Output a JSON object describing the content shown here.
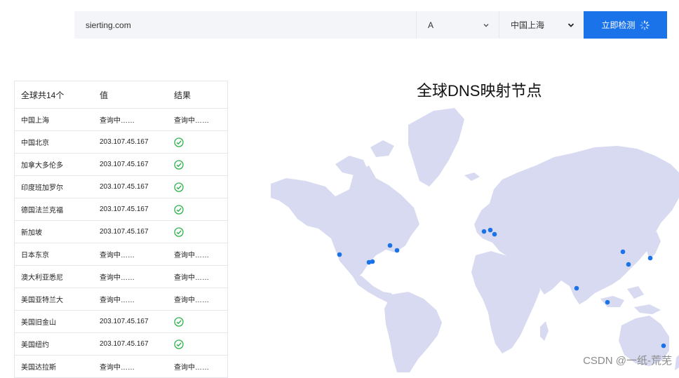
{
  "search": {
    "domain_value": "sierting.com",
    "record_type": "A",
    "region": "中国上海",
    "button_label": "立即检测"
  },
  "table": {
    "headers": [
      "全球共14个",
      "值",
      "结果"
    ],
    "rows": [
      {
        "location": "中国上海",
        "value": "查询中……",
        "result": "查询中……"
      },
      {
        "location": "中国北京",
        "value": "203.107.45.167",
        "result": "ok"
      },
      {
        "location": "加拿大多伦多",
        "value": "203.107.45.167",
        "result": "ok"
      },
      {
        "location": "印度班加罗尔",
        "value": "203.107.45.167",
        "result": "ok"
      },
      {
        "location": "德国法兰克福",
        "value": "203.107.45.167",
        "result": "ok"
      },
      {
        "location": "新加坡",
        "value": "203.107.45.167",
        "result": "ok"
      },
      {
        "location": "日本东京",
        "value": "查询中……",
        "result": "查询中……"
      },
      {
        "location": "澳大利亚悉尼",
        "value": "查询中……",
        "result": "查询中……"
      },
      {
        "location": "美国亚特兰大",
        "value": "查询中……",
        "result": "查询中……"
      },
      {
        "location": "美国旧金山",
        "value": "203.107.45.167",
        "result": "ok"
      },
      {
        "location": "美国纽约",
        "value": "203.107.45.167",
        "result": "ok"
      },
      {
        "location": "美国达拉斯",
        "value": "查询中……",
        "result": "查询中……"
      }
    ]
  },
  "map": {
    "title": "全球DNS映射节点",
    "land_color": "#d7daf0",
    "dot_color": "#1a73e8"
  },
  "watermark": "CSDN @一纸-荒芜",
  "colors": {
    "accent": "#1a73e8",
    "success": "#2bb24c",
    "input_bg": "#f4f5f8"
  }
}
